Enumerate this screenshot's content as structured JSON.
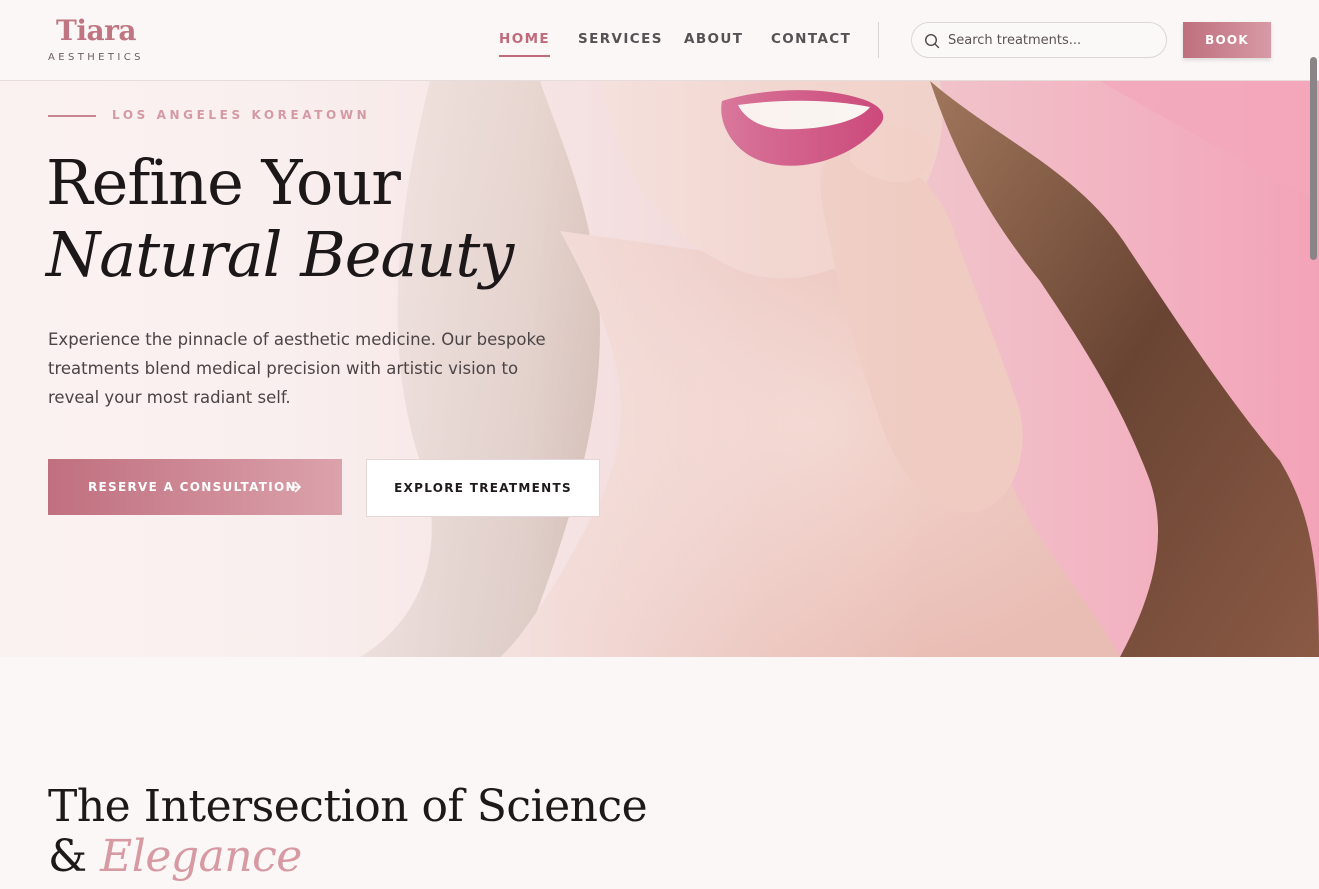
{
  "brand": {
    "name": "Tiara",
    "tagline": "AESTHETICS",
    "accent_color": "#c06a7a"
  },
  "nav": {
    "items": [
      {
        "label": "HOME",
        "active": true
      },
      {
        "label": "SERVICES",
        "active": false
      },
      {
        "label": "ABOUT",
        "active": false
      },
      {
        "label": "CONTACT",
        "active": false
      }
    ]
  },
  "search": {
    "placeholder": "Search treatments...",
    "value": "",
    "icon": "search-icon"
  },
  "header": {
    "book_label": "BOOK"
  },
  "hero": {
    "eyebrow": "LOS ANGELES KOREATOWN",
    "title_line1": "Refine Your",
    "title_line2": "Natural Beauty",
    "description": "Experience the pinnacle of aesthetic medicine. Our bespoke treatments blend medical precision with artistic vision to reveal your most radiant self.",
    "primary_cta": "RESERVE A CONSULTATION",
    "primary_cta_icon": "arrow-right-icon",
    "secondary_cta": "EXPLORE TREATMENTS",
    "image": "smiling-woman-portrait"
  },
  "section2": {
    "title_part1": "The Intersection of Science",
    "title_part2_prefix": "& ",
    "title_part2_accent": "Elegance"
  }
}
